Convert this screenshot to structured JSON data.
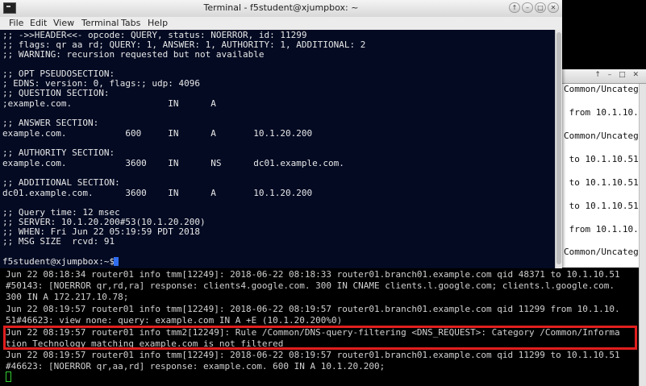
{
  "fg_window": {
    "title": "Terminal - f5student@xjumpbox: ~",
    "controls": [
      "↑",
      "–",
      "□",
      "✕"
    ],
    "menu": [
      "File",
      "Edit",
      "View",
      "Terminal",
      "Tabs",
      "Help"
    ],
    "lines": [
      ";; ->>HEADER<<- opcode: QUERY, status: NOERROR, id: 11299",
      ";; flags: qr aa rd; QUERY: 1, ANSWER: 1, AUTHORITY: 1, ADDITIONAL: 2",
      ";; WARNING: recursion requested but not available",
      "",
      ";; OPT PSEUDOSECTION:",
      "; EDNS: version: 0, flags:; udp: 4096",
      ";; QUESTION SECTION:",
      ";example.com.                  IN      A",
      "",
      ";; ANSWER SECTION:",
      "example.com.           600     IN      A       10.1.20.200",
      "",
      ";; AUTHORITY SECTION:",
      "example.com.           3600    IN      NS      dc01.example.com.",
      "",
      ";; ADDITIONAL SECTION:",
      "dc01.example.com.      3600    IN      A       10.1.20.200",
      "",
      ";; Query time: 12 msec",
      ";; SERVER: 10.1.20.200#53(10.1.20.200)",
      ";; WHEN: Fri Jun 22 05:19:59 PDT 2018",
      ";; MSG SIZE  rcvd: 91",
      "",
      "f5student@xjumpbox:~$ "
    ]
  },
  "bg_window": {
    "controls": "↑ – □ ✕",
    "side_lines": [
      "Common/Uncateg",
      "",
      " from 10.1.10.",
      "",
      "Common/Uncateg",
      "",
      " to 10.1.10.51",
      "",
      " to 10.1.10.51",
      "",
      " to 10.1.10.51",
      "",
      " from 10.1.10.",
      "",
      "Common/Uncateg"
    ],
    "log_lines": [
      "Jun 22 08:18:34 router01 info tmm[12249]: 2018-06-22 08:18:33 router01.branch01.example.com qid 48371 to 10.1.10.51",
      "#50143: [NOERROR qr,rd,ra] response: clients4.google.com. 300 IN CNAME clients.l.google.com; clients.l.google.com.",
      "300 IN A 172.217.10.78;",
      "Jun 22 08:19:57 router01 info tmm[12249]: 2018-06-22 08:19:57 router01.branch01.example.com qid 11299 from 10.1.10.",
      "51#46623: view none: query: example.com IN A +E (10.1.20.200%0)",
      "Jun 22 08:19:57 router01 info tmm2[12249]: Rule /Common/DNS-query-filtering <DNS_REQUEST>: Category /Common/Informa",
      "tion Technology matching example.com is not filtered",
      "Jun 22 08:19:57 router01 info tmm[12249]: 2018-06-22 08:19:57 router01.branch01.example.com qid 11299 to 10.1.10.51",
      "#46623: [NOERROR qr,aa,rd] response: example.com. 600 IN A 10.1.20.200;"
    ]
  },
  "colors": {
    "terminal_bg": "#030a22",
    "log_bg": "#000000",
    "highlight": "#e01e1e",
    "cursor_fg": "#2f6df0",
    "cursor_log": "#33cc33"
  }
}
